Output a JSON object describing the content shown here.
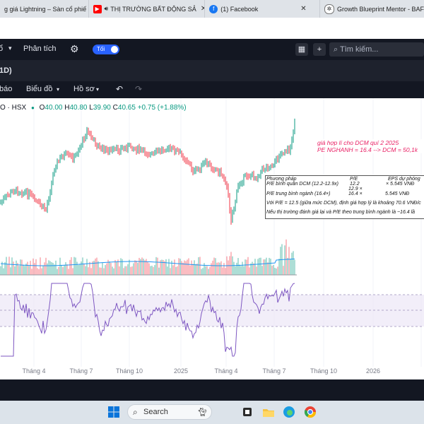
{
  "browser": {
    "tabs": [
      {
        "title": "g giá Lightning – Sàn cổ phiế",
        "icon": "lightning-icon",
        "color": "#e53935"
      },
      {
        "title": "THỊ TRƯỜNG BẤT ĐỘNG SẢ",
        "icon": "youtube-icon",
        "color": "#ff0000"
      },
      {
        "title": "(1) Facebook",
        "icon": "facebook-icon",
        "color": "#1877f2"
      },
      {
        "title": "Growth Blueprint Mentor - BAF",
        "icon": "chatgpt-icon",
        "color": "#202124"
      }
    ]
  },
  "header": {
    "truncated_left": "ổ",
    "analysis_label": "Phân tích",
    "theme_label": "Tối",
    "search_placeholder": "Tìm kiếm...",
    "interval_label": "1D)"
  },
  "toolbar": {
    "report_label": "báo",
    "chart_label": "Biểu đồ",
    "profile_label": "Hồ sơ"
  },
  "symbol": {
    "name": "O · HSX",
    "open_label": "O",
    "open": "40.00",
    "high_label": "H",
    "high": "40.80",
    "low_label": "L",
    "low": "39.90",
    "close_label": "C",
    "close": "40.65",
    "change": "+0.75 (+1.88%)"
  },
  "annotations": {
    "line1": "giá hợp lí cho DCM quí 2 2025",
    "line2": "PE NGHANH   = 16.4 --> DCM = 50,1k",
    "table": {
      "h_method": "Phương pháp",
      "h_pe": "P/E",
      "h_eps": "EPS dự phóng",
      "r1_method": "P/E bình quân DCM (12.2-12.9x)",
      "r1_pe": "12.2",
      "r1_pe2": "12.9 ×",
      "r1_eps": "× 5.545 VNĐ",
      "r2_method": "P/E trung bình ngành (16.4×)",
      "r2_pe": "16.4 ×",
      "r2_eps": "5.545 VNĐ",
      "note1": "Với P/E = 12.5 (giữa mức DCM), định giá hợp lý là khoảng 70.6 VNĐ/c",
      "note2": "Nếu thị trường đánh giá lại và P/E theo trung bình ngành là ~16.4 lầ"
    }
  },
  "time_axis": [
    "Tháng 4",
    "Tháng 7",
    "Tháng 10",
    "2025",
    "Tháng 4",
    "Tháng 7",
    "Tháng 10",
    "2026"
  ],
  "taskbar": {
    "search_label": "Search",
    "icons": [
      "windows-start-icon",
      "search-icon",
      "cat-widget-icon",
      "task-view-icon",
      "file-explorer-icon",
      "edge-icon",
      "chrome-icon"
    ]
  },
  "colors": {
    "up": "#089981",
    "down": "#f23645",
    "rsi": "#7e57c2",
    "annotation": "#e91e63",
    "accent": "#2962ff"
  }
}
